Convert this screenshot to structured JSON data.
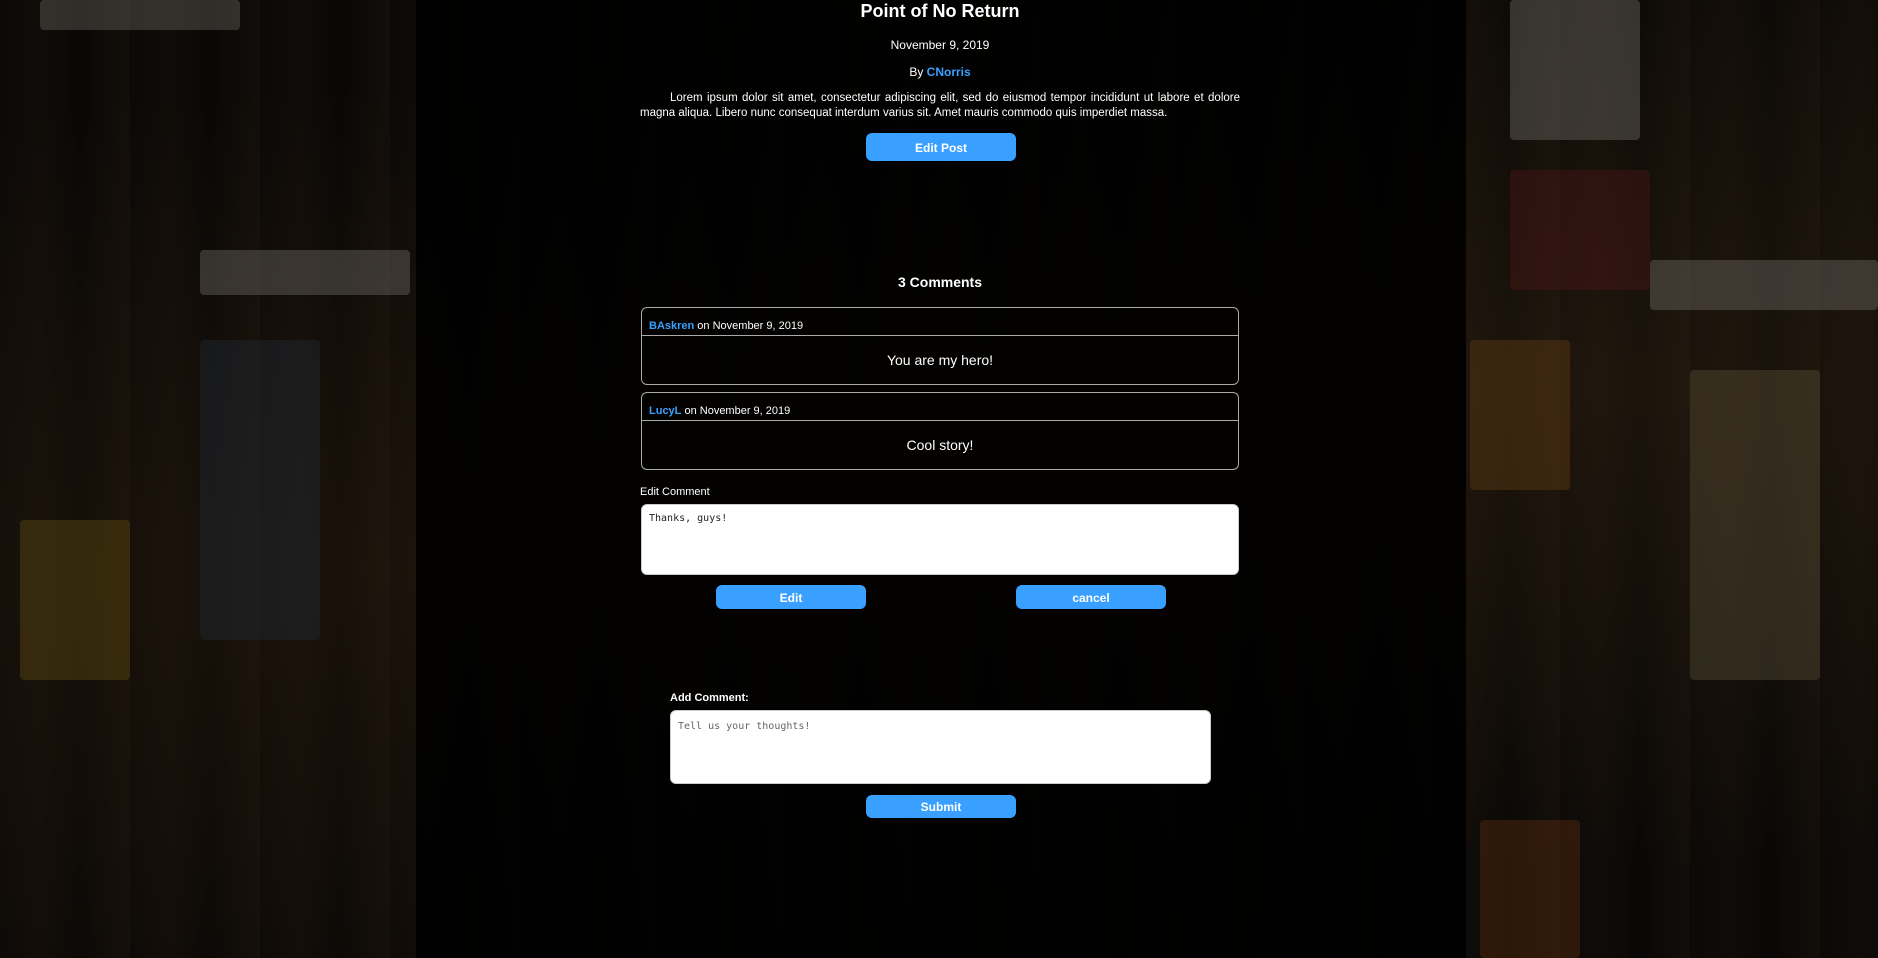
{
  "post": {
    "title": "Point of No Return",
    "date": "November 9, 2019",
    "by_label": "By",
    "author": "CNorris",
    "body": "Lorem ipsum dolor sit amet, consectetur adipiscing elit, sed do eiusmod tempor incididunt ut labore et dolore magna aliqua. Libero nunc consequat interdum varius sit. Amet mauris commodo quis imperdiet massa.",
    "edit_button_label": "Edit Post"
  },
  "comments": {
    "count_label": "3 Comments",
    "items": [
      {
        "author": "BAskren",
        "on_label": " on November 9, 2019",
        "text": "You are my hero!"
      },
      {
        "author": "LucyL",
        "on_label": " on November 9, 2019",
        "text": "Cool story!"
      }
    ]
  },
  "edit_comment": {
    "label": "Edit Comment",
    "value": "Thanks, guys!",
    "edit_button_label": "Edit",
    "cancel_button_label": "cancel"
  },
  "add_comment": {
    "label": "Add Comment:",
    "placeholder": "Tell us your thoughts!",
    "submit_button_label": "Submit"
  },
  "colors": {
    "accent": "#3aa0ff",
    "background": "#000000"
  }
}
